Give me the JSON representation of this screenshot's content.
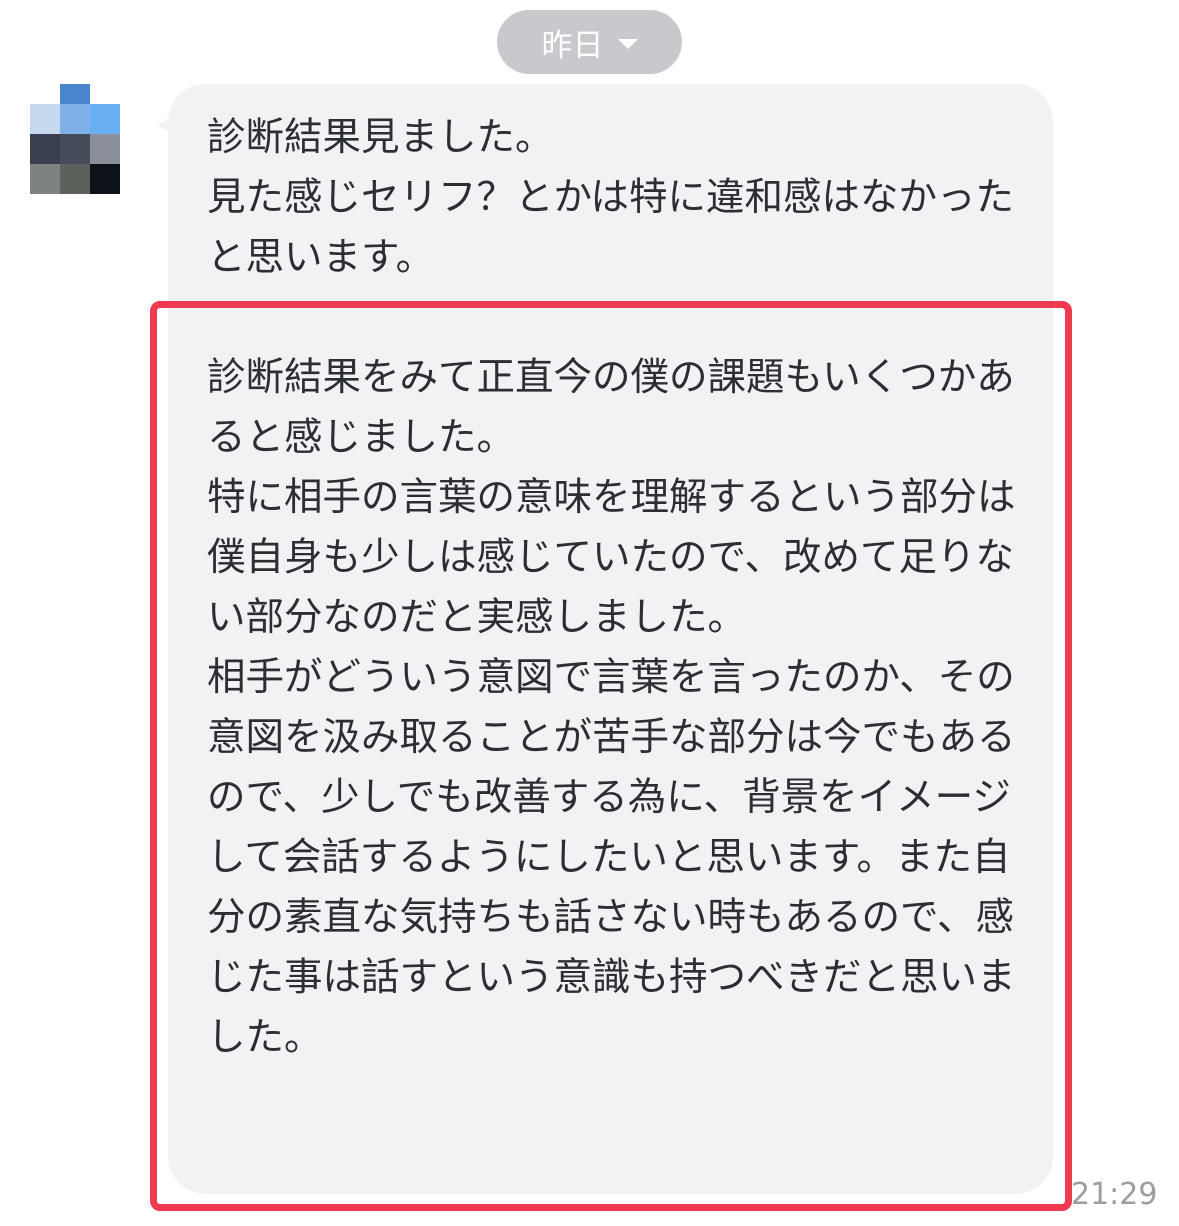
{
  "date_separator": {
    "label": "昨日",
    "icon": "chevron-down-icon"
  },
  "avatar": {
    "icon": "pixelated-avatar",
    "pixels": [
      {
        "col": 1,
        "row": 0,
        "color": "#4a84d0"
      },
      {
        "col": 0,
        "row": 1,
        "color": "#c5d8ed"
      },
      {
        "col": 1,
        "row": 1,
        "color": "#7fb0e8"
      },
      {
        "col": 2,
        "row": 1,
        "color": "#6aaff2"
      },
      {
        "col": 0,
        "row": 2,
        "color": "#3a4050"
      },
      {
        "col": 1,
        "row": 2,
        "color": "#454b58"
      },
      {
        "col": 2,
        "row": 2,
        "color": "#8a8f9b"
      },
      {
        "col": 0,
        "row": 3,
        "color": "#7d8480"
      },
      {
        "col": 1,
        "row": 3,
        "color": "#5b625c"
      },
      {
        "col": 2,
        "row": 3,
        "color": "#0d1218"
      }
    ]
  },
  "message": {
    "first_text": "診断結果見ました。\n見た感じセリフ？とかは特に違和感はなかったと思います。",
    "second_text": "診断結果をみて正直今の僕の課題もいくつかあると感じました。\n特に相手の言葉の意味を理解するという部分は僕自身も少しは感じていたので、改めて足りない部分なのだと実感しました。\n相手がどういう意図で言葉を言ったのか、その意図を汲み取ることが苦手な部分は今でもあるので、少しでも改善する為に、背景をイメージして会話するようにしたいと思います。また自分の素直な気持ちも話さない時もあるので、感じた事は話すという意識も持つべきだと思いました。",
    "timestamp": "21:29"
  },
  "colors": {
    "bubble": "#f1f2f4",
    "highlight": "#f03a52",
    "date_pill": "#c7c9cd",
    "text": "#2b2e33",
    "timestamp": "#9a9da3"
  }
}
